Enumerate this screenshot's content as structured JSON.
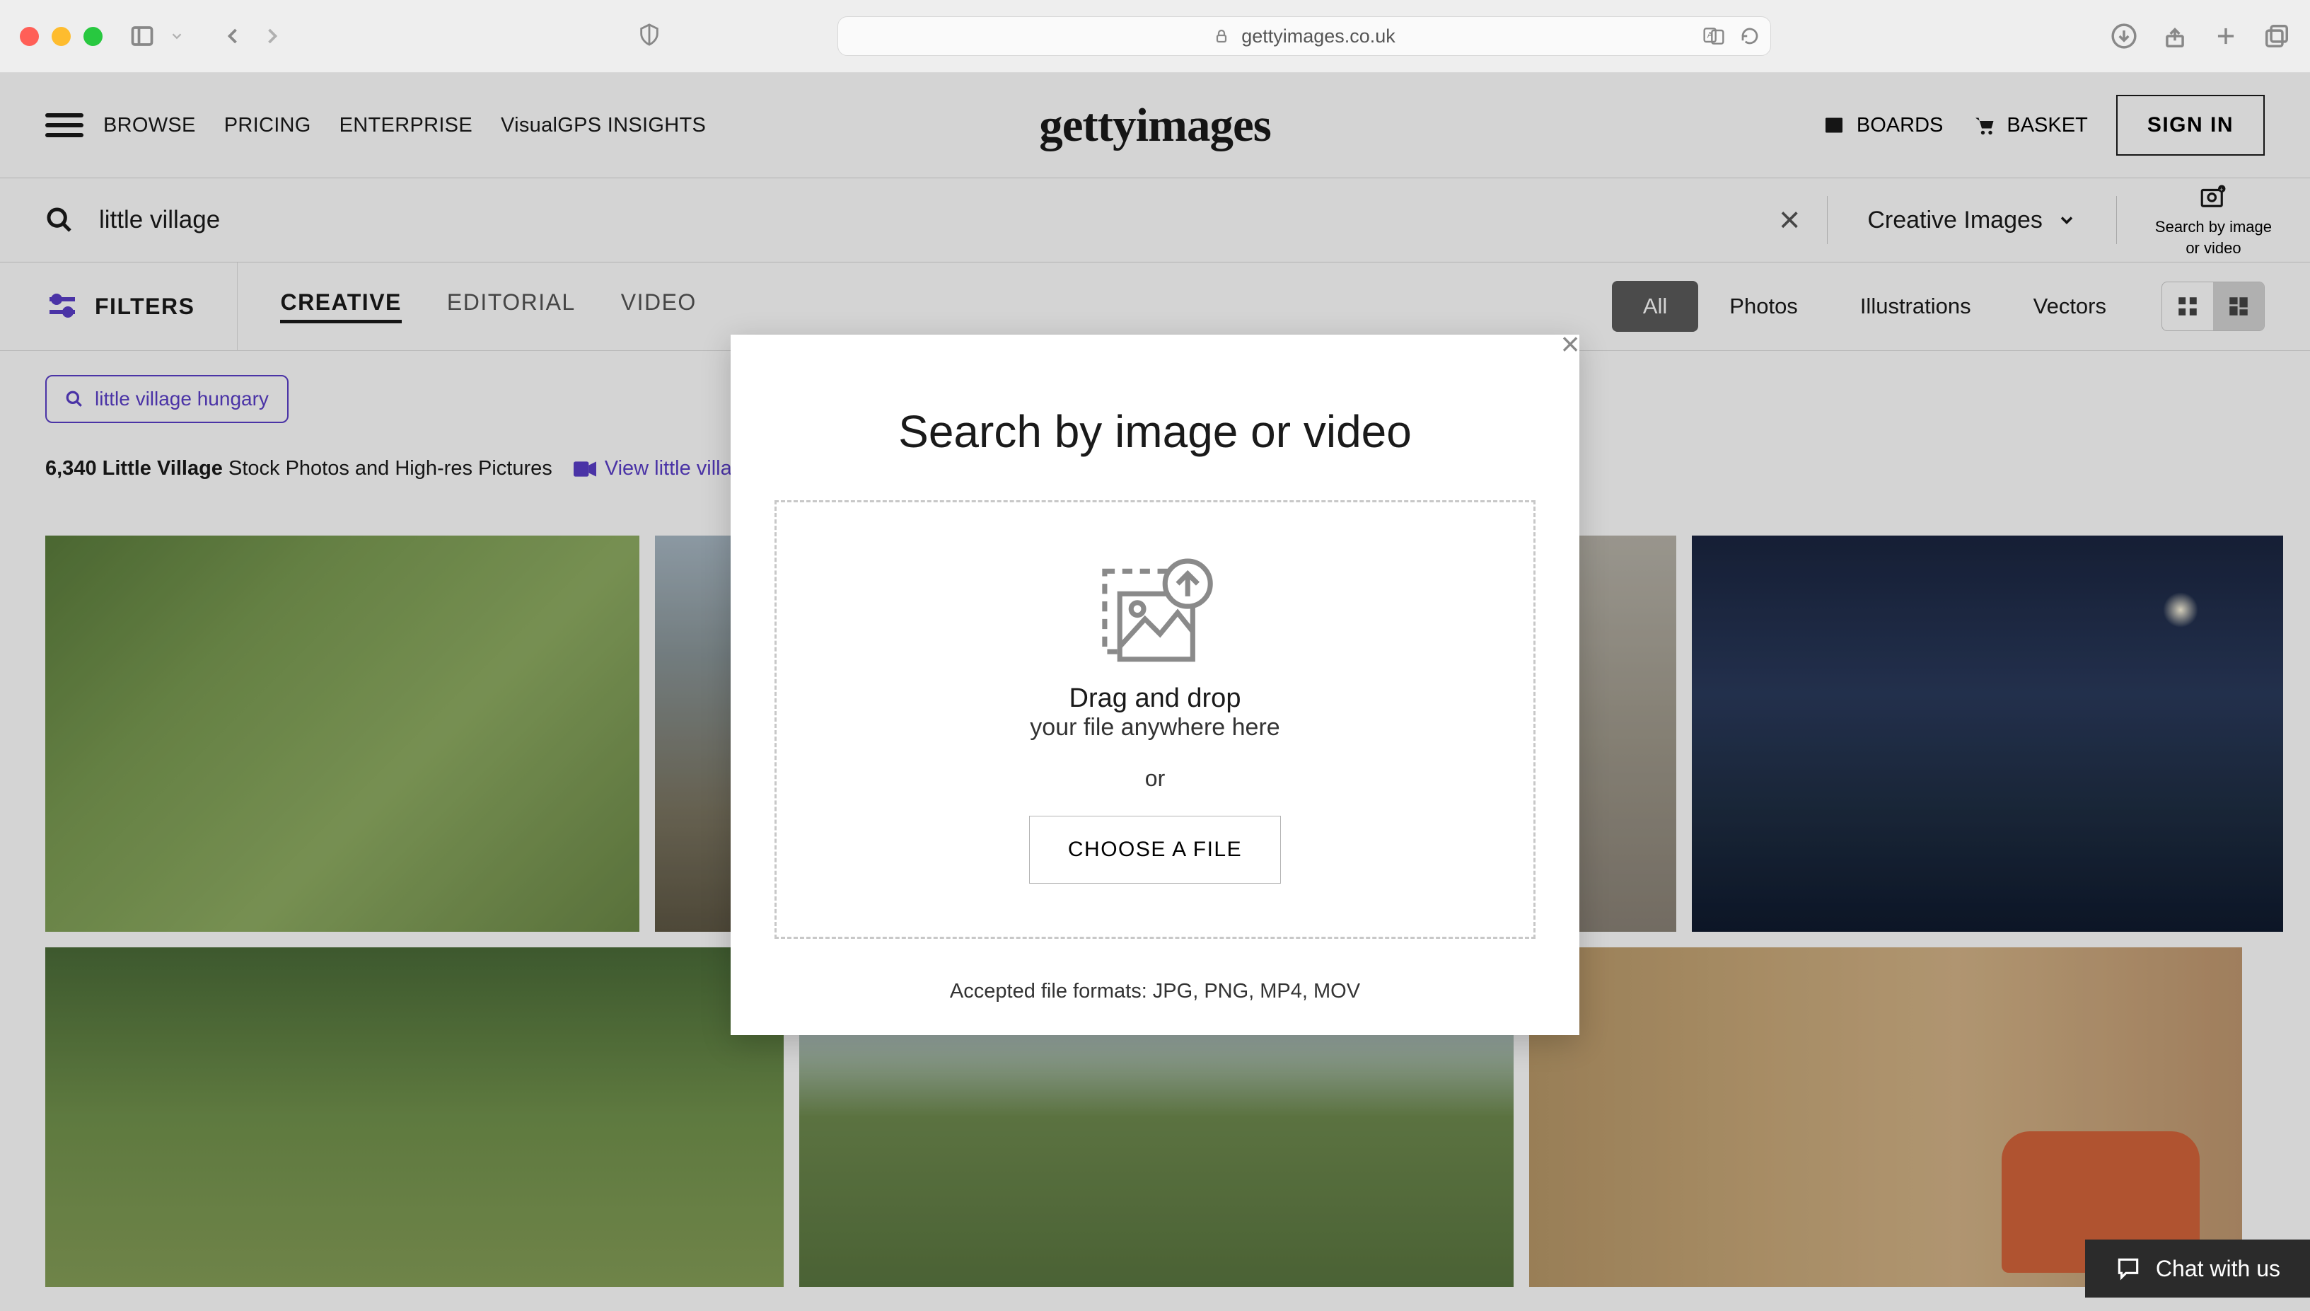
{
  "browser": {
    "url": "gettyimages.co.uk"
  },
  "topnav": {
    "browse": "BROWSE",
    "pricing": "PRICING",
    "enterprise": "ENTERPRISE",
    "visualgps": "VisualGPS INSIGHTS",
    "brand": "gettyimages",
    "boards": "BOARDS",
    "basket": "BASKET",
    "signin": "SIGN IN"
  },
  "searchbar": {
    "value": "little village",
    "creative_label": "Creative Images",
    "sbi_line1": "Search by image",
    "sbi_line2": "or video"
  },
  "filterrow": {
    "filters": "FILTERS",
    "tabs": {
      "creative": "CREATIVE",
      "editorial": "EDITORIAL",
      "video": "VIDEO"
    },
    "pills": {
      "all": "All",
      "photos": "Photos",
      "illustrations": "Illustrations",
      "vectors": "Vectors"
    }
  },
  "related": {
    "pill": "little village hungary"
  },
  "results": {
    "count": "6,340",
    "count_bold": "Little Village",
    "count_rest": " Stock Photos and High-res Pictures",
    "video_link": "View little villa"
  },
  "modal": {
    "title": "Search by image or video",
    "drag_line1": "Drag and drop",
    "drag_line2": "your file anywhere here",
    "or": "or",
    "choose": "CHOOSE A FILE",
    "formats": "Accepted file formats: JPG, PNG, MP4, MOV"
  },
  "chat": {
    "label": "Chat with us"
  }
}
